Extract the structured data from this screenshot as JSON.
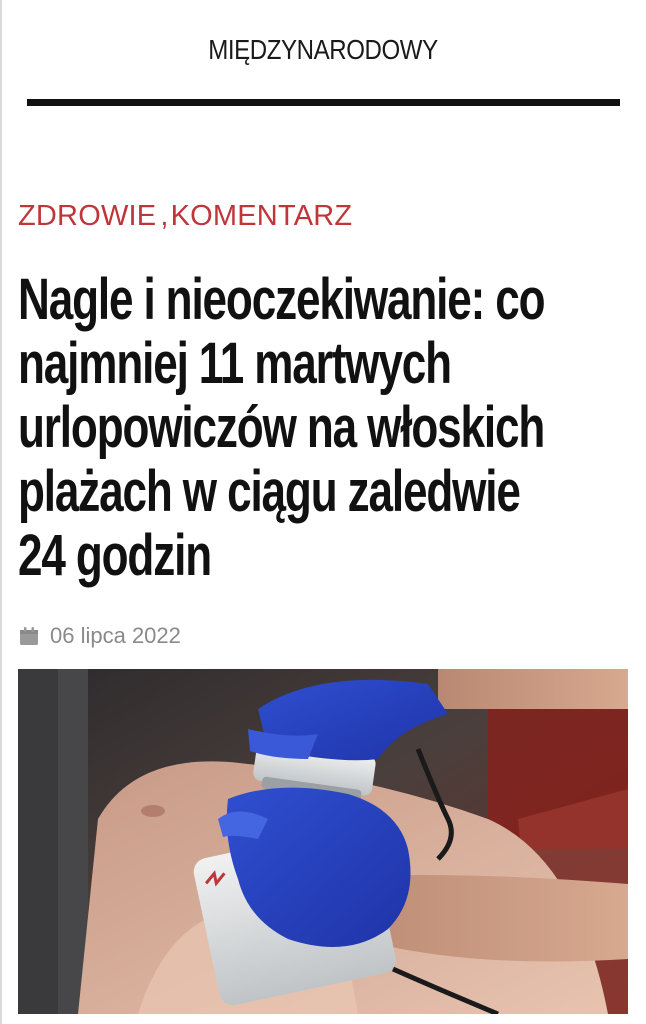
{
  "header": {
    "section": "MIĘDZYNARODOWY"
  },
  "article": {
    "categories": [
      "ZDROWIE",
      "KOMENTARZ"
    ],
    "category_separator": ",",
    "headline_lines": [
      "Nagle i nieoczekiwanie: co",
      "najmniej 11 martwych",
      "urlopowiczów na włoskich",
      "plażach w ciągu zaledwie",
      "24 godzin"
    ],
    "date": "06 lipca 2022",
    "date_icon": "calendar-icon"
  },
  "colors": {
    "category": "#c0353a",
    "headline": "#111111",
    "meta": "#8a8a8a",
    "rule": "#111111"
  }
}
